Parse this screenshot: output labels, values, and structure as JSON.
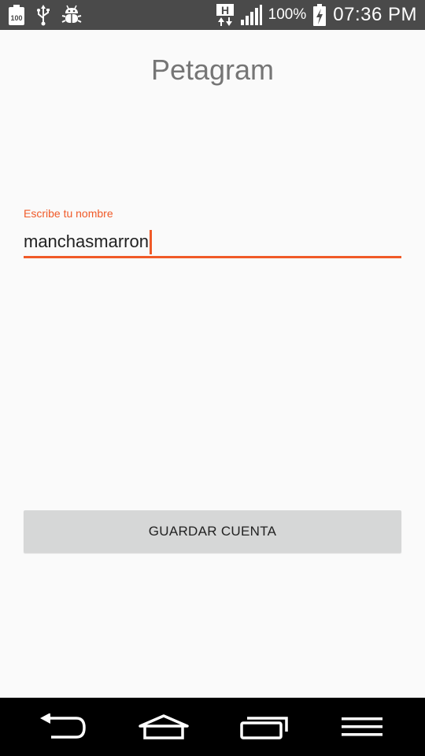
{
  "status_bar": {
    "battery_badge": "100",
    "battery_percent": "100%",
    "network_type": "H",
    "time": "07:36 PM",
    "icons": [
      "battery-100-icon",
      "usb-icon",
      "debug-bug-icon",
      "hspa-data-icon",
      "signal-bars-icon",
      "battery-charging-icon"
    ]
  },
  "app": {
    "title": "Petagram"
  },
  "form": {
    "name_label": "Escribe tu nombre",
    "name_value": "manchasmarron"
  },
  "actions": {
    "save_label": "GUARDAR CUENTA"
  },
  "nav_bar": {
    "icons": [
      "back-icon",
      "home-icon",
      "recent-apps-icon",
      "menu-icon"
    ]
  },
  "colors": {
    "accent": "#f05a28",
    "title_text": "#757575",
    "background": "#fafafa",
    "button_bg": "#d6d7d7",
    "status_bar_bg": "#4a4a4a",
    "nav_bar_bg": "#000000"
  }
}
